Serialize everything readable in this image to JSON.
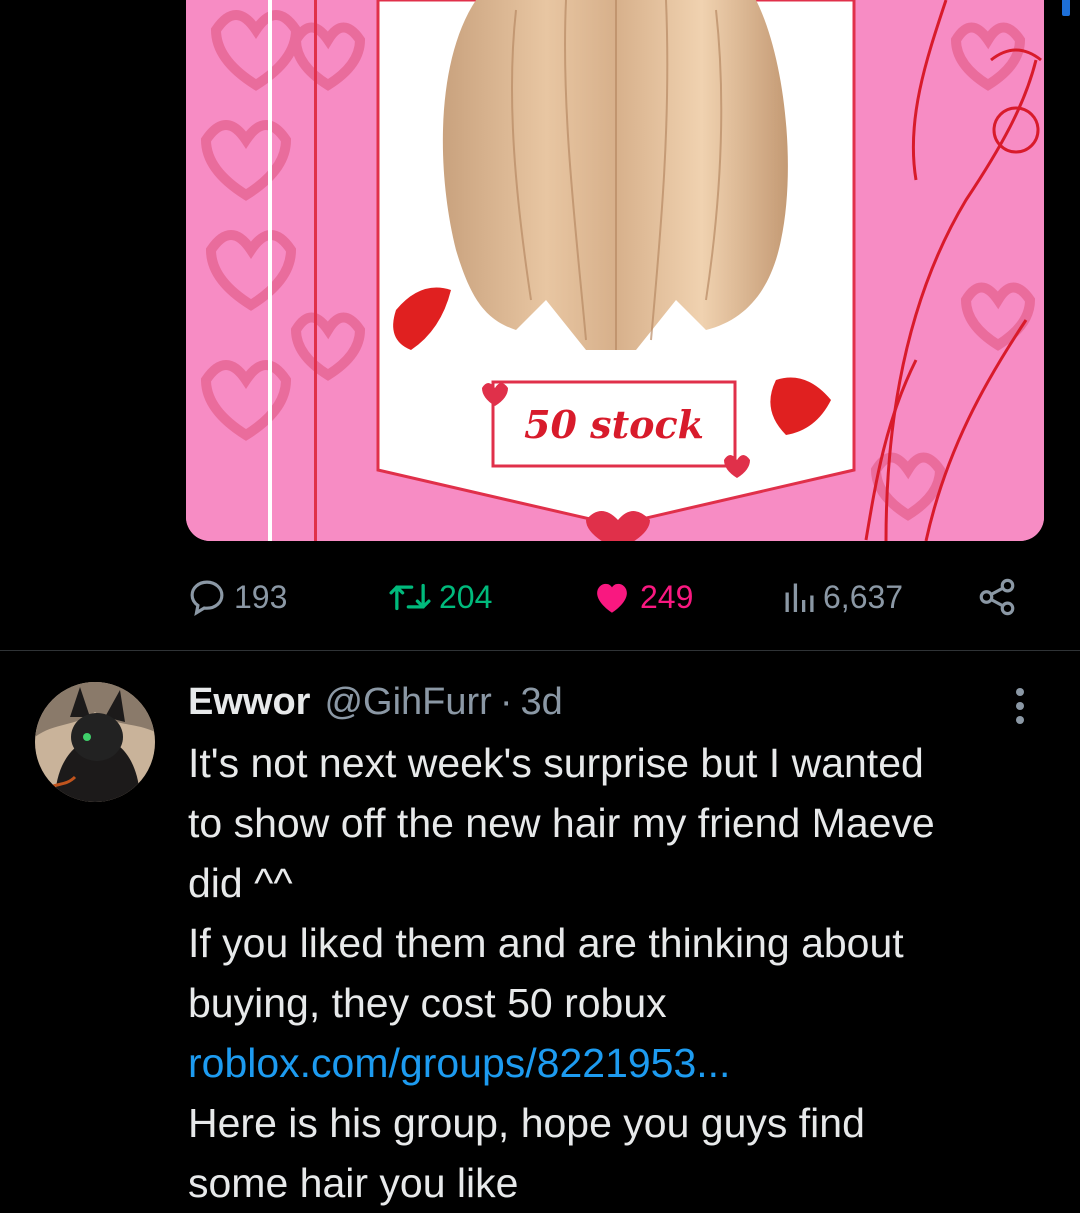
{
  "media": {
    "stock_label": "50 stock"
  },
  "actions": {
    "reply_count": "193",
    "retweet_count": "204",
    "like_count": "249",
    "views_count": "6,637"
  },
  "colors": {
    "background": "#000000",
    "text": "#e7e9ea",
    "muted": "#8b98a5",
    "retweet": "#00ba7c",
    "like": "#f91880",
    "link": "#1d9bf0"
  },
  "reply": {
    "author_name": "Ewwor",
    "handle": "@GihFurr",
    "separator": "·",
    "time": "3d",
    "lines": [
      "It's not next week's surprise but I wanted",
      "to show off the new hair my friend Maeve",
      "did ^^",
      "If you liked them and are thinking about",
      "buying, they cost 50 robux"
    ],
    "link_text": "roblox.com/groups/8221953...",
    "after_link_lines": [
      "Here is his group, hope you guys find",
      "some hair you like"
    ]
  }
}
